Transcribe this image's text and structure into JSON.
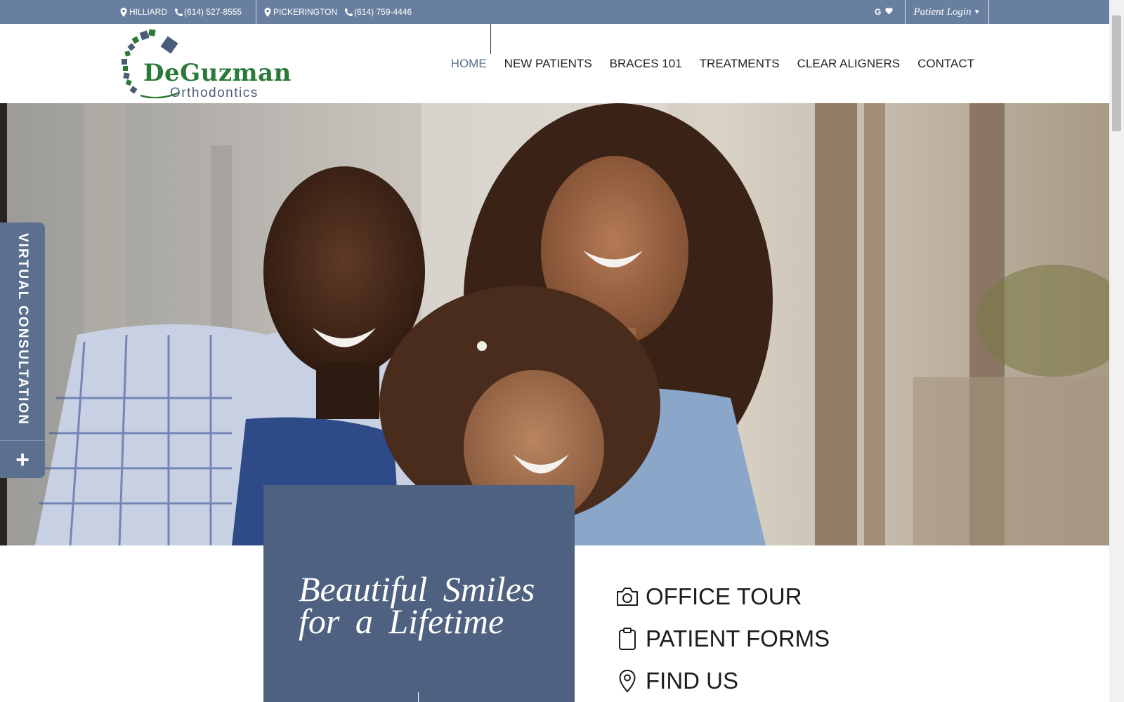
{
  "topbar": {
    "location_1": {
      "name": "HILLIARD",
      "phone": "(614) 527-8555",
      "pin_icon": "map-pin-icon",
      "phone_icon": "phone-icon"
    },
    "location_2": {
      "name": "PICKERINGTON",
      "phone": "(614) 759-4446",
      "pin_icon": "map-pin-icon",
      "phone_icon": "phone-icon"
    },
    "social": {
      "google_label": "G",
      "heart_icon": "heart-icon"
    },
    "patient_login": "Patient Login",
    "bg_color": "#687f9f"
  },
  "header": {
    "logo": {
      "line_1": "DeGuzman",
      "line_2": "Orthodontics",
      "green": "#2c7a3a",
      "slate": "#4a5d78"
    },
    "nav": [
      {
        "label": "HOME",
        "active": true
      },
      {
        "label": "NEW PATIENTS",
        "active": false
      },
      {
        "label": "BRACES 101",
        "active": false
      },
      {
        "label": "TREATMENTS",
        "active": false
      },
      {
        "label": "CLEAR ALIGNERS",
        "active": false
      },
      {
        "label": "CONTACT",
        "active": false
      }
    ]
  },
  "hero": {
    "image": "family-photo"
  },
  "virtual_consultation": {
    "label": "VIRTUAL CONSULTATION",
    "plus": "+",
    "color": "#5b6f8e"
  },
  "tagline": {
    "line_1": "Beautiful Smiles",
    "line_2": "for a Lifetime",
    "panel_color": "#4e6180"
  },
  "quick_links": [
    {
      "label": "OFFICE TOUR",
      "icon": "camera-icon"
    },
    {
      "label": "PATIENT FORMS",
      "icon": "clipboard-icon"
    },
    {
      "label": "FIND US",
      "icon": "map-pin-icon"
    }
  ]
}
